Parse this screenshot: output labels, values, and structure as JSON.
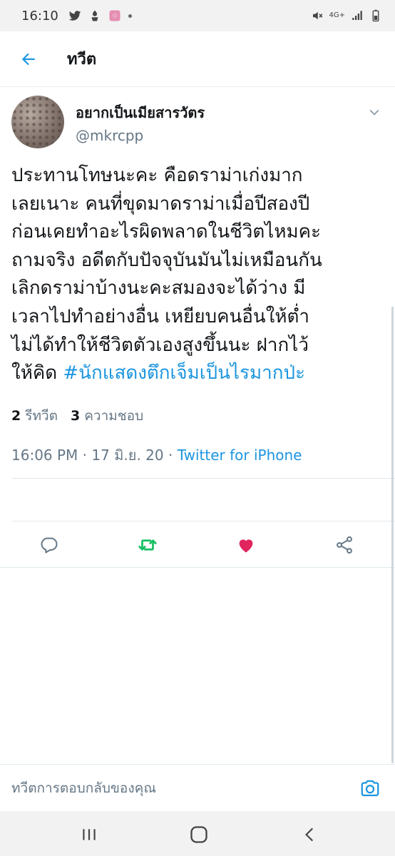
{
  "status_bar": {
    "time": "16:10",
    "network": "4G+"
  },
  "header": {
    "title": "ทวีต"
  },
  "tweet": {
    "display_name": "อยากเป็นเมียสารวัตร",
    "handle": "@mkrcpp",
    "text_lines": [
      "ประทานโทษนะคะ คือดราม่าเก่งมาก",
      "เลยเนาะ คนที่ขุดมาดราม่าเมื่อปีสองปี",
      "ก่อนเคยทำอะไรผิดพลาดในชีวิตไหมคะ",
      "ถามจริง อดีตกับปัจจุบันมันไม่เหมือนกัน",
      "เลิกดราม่าบ้างนะคะสมองจะได้ว่าง มี",
      "เวลาไปทำอย่างอื่น เหยียบคนอื่นให้ต่ำ",
      "ไม่ได้ทำให้ชีวิตตัวเองสูงขึ้นนะ ฝากไว้"
    ],
    "last_line_prefix": "ให้คิด ",
    "hashtag": "#นักแสดงตึกเจ็มเป็นไรมากป่ะ",
    "time": "16:06 PM",
    "date": "17 มิ.ย. 20",
    "separator": " · ",
    "source": "Twitter for iPhone",
    "retweets_count": "2",
    "retweets_label": "รีทวีต",
    "likes_count": "3",
    "likes_label": "ความชอบ"
  },
  "reply_bar": {
    "placeholder": "ทวีตการตอบกลับของคุณ"
  },
  "colors": {
    "accent": "#1b95e0",
    "retweet": "#17bf63",
    "like": "#e0245e",
    "secondary_text": "#657786"
  }
}
